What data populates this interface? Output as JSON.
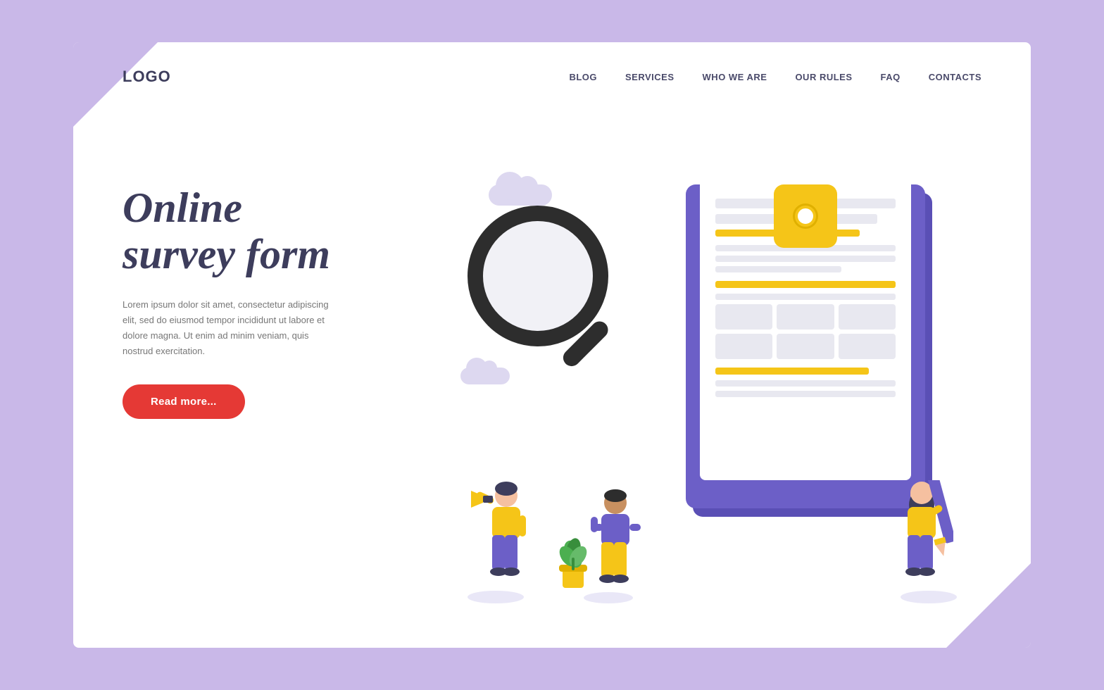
{
  "page": {
    "background_color": "#c9b8e8",
    "card_background": "#ffffff"
  },
  "header": {
    "logo": "LOGO",
    "nav_items": [
      {
        "label": "BLOG",
        "id": "blog"
      },
      {
        "label": "SERVICES",
        "id": "services"
      },
      {
        "label": "WHO WE ARE",
        "id": "who-we-are"
      },
      {
        "label": "OUR RULES",
        "id": "our-rules"
      },
      {
        "label": "FAQ",
        "id": "faq"
      },
      {
        "label": "CONTACTS",
        "id": "contacts"
      }
    ]
  },
  "hero": {
    "title_line1": "Online",
    "title_line2": "survey form",
    "description": "Lorem ipsum dolor sit amet, consectetur adipiscing elit,\nsed do eiusmod tempor incididunt ut labore et dolore magna.\nUt enim ad minim veniam, quis nostrud exercitation.",
    "cta_button": "Read more..."
  },
  "colors": {
    "purple": "#6c5fc7",
    "yellow": "#f5c518",
    "red": "#e53935",
    "dark_text": "#3d3d5c",
    "gray_text": "#777777",
    "cloud": "#ddd8f0",
    "magnifier": "#2d2d2d"
  }
}
